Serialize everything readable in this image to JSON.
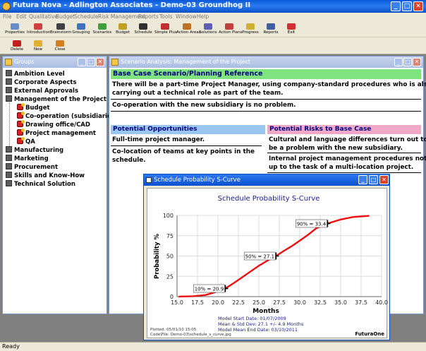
{
  "app": {
    "title": "Futura Nova - Adlington Associates - Demo-03 Groundhog II",
    "minimize": "_",
    "maximize": "□",
    "close": "✕"
  },
  "menu": [
    "File",
    "Edit",
    "Qualitative",
    "Budget",
    "Schedule",
    "Risk Management",
    "Reports",
    "Tools",
    "Window",
    "Help"
  ],
  "toolbar1": [
    {
      "label": "Properties",
      "icon": "properties-icon",
      "color": "#6a8cc8"
    },
    {
      "label": "Introduction",
      "icon": "introduction-icon",
      "color": "#d04040"
    },
    {
      "label": "Brainstorm",
      "icon": "brainstorm-icon",
      "color": "#404040"
    },
    {
      "label": "Grouping",
      "icon": "grouping-icon",
      "color": "#4070c0"
    },
    {
      "label": "Scenarios",
      "icon": "scenarios-icon",
      "color": "#40a040"
    },
    {
      "label": "Budget",
      "icon": "budget-icon",
      "color": "#c0a020"
    },
    {
      "label": "Schedule",
      "icon": "schedule-icon",
      "color": "#303030"
    },
    {
      "label": "Simple Plus",
      "icon": "simple-plus-icon",
      "color": "#c03030"
    },
    {
      "label": "Action Areas",
      "icon": "action-areas-icon",
      "color": "#c07020"
    },
    {
      "label": "Solutions",
      "icon": "solutions-icon",
      "color": "#6060b0"
    },
    {
      "label": "Action Plans",
      "icon": "action-plans-icon",
      "color": "#c04040"
    },
    {
      "label": "Progress",
      "icon": "progress-icon",
      "color": "#d0b030"
    },
    {
      "label": "Reports",
      "icon": "reports-icon",
      "color": "#4060a0"
    },
    {
      "label": "Exit",
      "icon": "exit-icon",
      "color": "#d03030"
    }
  ],
  "toolbar2": [
    {
      "label": "Delete",
      "icon": "delete-icon",
      "color": "#c02020"
    },
    {
      "label": "New",
      "icon": "new-icon",
      "color": "#e0b030"
    },
    {
      "label": "Close",
      "icon": "close-doc-icon",
      "color": "#d08020"
    }
  ],
  "groups": {
    "title": "Groups",
    "items": [
      {
        "label": "Ambition Level",
        "level": 0
      },
      {
        "label": "Corporate Aspects",
        "level": 0
      },
      {
        "label": "External Approvals",
        "level": 0
      },
      {
        "label": "Management of the Project",
        "level": 0
      },
      {
        "label": "Budget",
        "level": 1
      },
      {
        "label": "Co-operation (subsidiaries",
        "level": 1
      },
      {
        "label": "Drawing office/CAD",
        "level": 1
      },
      {
        "label": "Project management",
        "level": 1
      },
      {
        "label": "QA",
        "level": 1
      },
      {
        "label": "Manufacturing",
        "level": 0
      },
      {
        "label": "Marketing",
        "level": 0
      },
      {
        "label": "Procurement",
        "level": 0
      },
      {
        "label": "Skills and Know-How",
        "level": 0
      },
      {
        "label": "Technical Solution",
        "level": 0
      }
    ]
  },
  "scenario": {
    "title": "Scenario Analysis: Management of the Project",
    "base_header": "Base Case Scenario/Planning Reference",
    "base_lines": [
      "There will be a part-time Project Manager, using company-standard procedures who is also",
      "carrying out a technical role as part of the team.",
      "Co-operation with the new subsidiary is no problem."
    ],
    "opportunities_header": "Potential Opportunities",
    "opportunities_lines": [
      "Full-time project manager.",
      "Co-location of teams at key points in the",
      "schedule."
    ],
    "risks_header": "Potential Risks to Base Case",
    "risks_lines": [
      "Cultural and language differences turn out to",
      "be a problem with the new subsidiary.",
      "Internal project management procedures not",
      "up to the task of a multi-location project."
    ]
  },
  "scurve": {
    "window_title": "Schedule Probability S-Curve",
    "footer_left": [
      "Plotted: 05/01/10 15:05",
      "Code\\File: Demo-03\\schedule_s_curve.jpg"
    ],
    "brand": "FuturaOne",
    "info": [
      "Model Start Date:  01/07/2009",
      "Mean & Std Dev:         27.1 +/- 4.9 Months",
      "Model Mean End Date:  03/10/2011"
    ],
    "colors": {
      "curve": "#ee1111",
      "title": "#1a1a8c",
      "info": "#1a1a8c"
    }
  },
  "chart_data": {
    "type": "line",
    "title": "Schedule Probability S-Curve",
    "xlabel": "Months",
    "ylabel": "Probability %",
    "xlim": [
      15.0,
      40.0
    ],
    "ylim": [
      0,
      100
    ],
    "xticks": [
      "15.0",
      "17.5",
      "20.0",
      "22.5",
      "25.0",
      "27.5",
      "30.0",
      "32.5",
      "35.0",
      "37.5",
      "40.0"
    ],
    "yticks": [
      "0",
      "25",
      "50",
      "75",
      "100"
    ],
    "grid": true,
    "series": [
      {
        "values": [
          {
            "x": 15.2,
            "y": 0
          },
          {
            "x": 17.0,
            "y": 0.5
          },
          {
            "x": 18.5,
            "y": 2
          },
          {
            "x": 19.5,
            "y": 5
          },
          {
            "x": 20.9,
            "y": 10
          },
          {
            "x": 22.0,
            "y": 17
          },
          {
            "x": 23.0,
            "y": 24
          },
          {
            "x": 24.0,
            "y": 31
          },
          {
            "x": 25.0,
            "y": 38
          },
          {
            "x": 26.0,
            "y": 44
          },
          {
            "x": 27.1,
            "y": 50
          },
          {
            "x": 28.0,
            "y": 56
          },
          {
            "x": 29.0,
            "y": 62
          },
          {
            "x": 30.0,
            "y": 69
          },
          {
            "x": 31.0,
            "y": 76
          },
          {
            "x": 32.0,
            "y": 84
          },
          {
            "x": 33.4,
            "y": 90
          },
          {
            "x": 35.0,
            "y": 95
          },
          {
            "x": 36.5,
            "y": 98
          },
          {
            "x": 38.5,
            "y": 99.5
          }
        ]
      }
    ],
    "annotations": [
      {
        "label": "10% = 20.9",
        "x": 20.9,
        "y": 10
      },
      {
        "label": "50% = 27.1",
        "x": 27.1,
        "y": 50
      },
      {
        "label": "90% = 33.4",
        "x": 33.4,
        "y": 90
      }
    ]
  },
  "status": {
    "text": "Ready"
  }
}
